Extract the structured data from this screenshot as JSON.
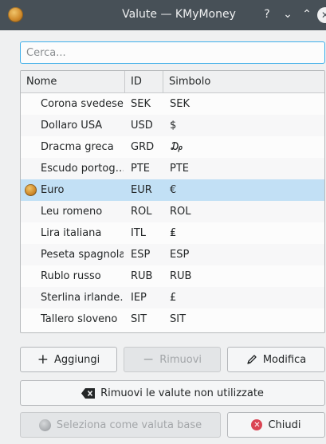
{
  "window": {
    "title": "Valute — KMyMoney",
    "help": "?",
    "minimize": "⌄",
    "maximize": "⌃",
    "close": "✕"
  },
  "search": {
    "placeholder": "Cerca..."
  },
  "table": {
    "columns": [
      "Nome",
      "ID",
      "Simbolo"
    ],
    "rows": [
      {
        "nome": "Corona svedese",
        "id": "SEK",
        "simbolo": "SEK"
      },
      {
        "nome": "Dollaro USA",
        "id": "USD",
        "simbolo": "$"
      },
      {
        "nome": "Dracma greca",
        "id": "GRD",
        "simbolo": "₯"
      },
      {
        "nome": "Escudo portog…",
        "id": "PTE",
        "simbolo": "PTE"
      },
      {
        "nome": "Euro",
        "id": "EUR",
        "simbolo": "€",
        "selected": true,
        "base": true
      },
      {
        "nome": "Leu romeno",
        "id": "ROL",
        "simbolo": "ROL"
      },
      {
        "nome": "Lira italiana",
        "id": "ITL",
        "simbolo": "₤"
      },
      {
        "nome": "Peseta spagnola",
        "id": "ESP",
        "simbolo": "ESP"
      },
      {
        "nome": "Rublo russo",
        "id": "RUB",
        "simbolo": "RUB"
      },
      {
        "nome": "Sterlina irlande…",
        "id": "IEP",
        "simbolo": "£"
      },
      {
        "nome": "Tallero sloveno",
        "id": "SIT",
        "simbolo": "SIT"
      }
    ]
  },
  "buttons": {
    "add": "Aggiungi",
    "remove": "Rimuovi",
    "edit": "Modifica",
    "remove_unused": "Rimuovi le valute non utilizzate",
    "set_base": "Seleziona come valuta base",
    "close": "Chiudi"
  },
  "colors": {
    "titlebar": "#475057",
    "selection": "#c2e0f5",
    "focus": "#3daee9",
    "close_badge": "#da4453"
  }
}
